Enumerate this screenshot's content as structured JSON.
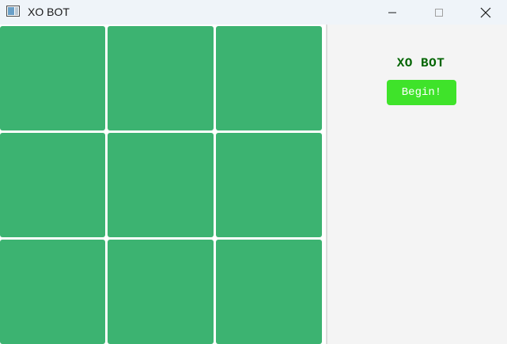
{
  "window": {
    "title": "XO BOT",
    "app_icon": "window-app-icon",
    "controls": [
      "minimize-icon",
      "maximize-icon",
      "close-icon"
    ]
  },
  "board": {
    "cells": [
      "",
      "",
      "",
      "",
      "",
      "",
      "",
      "",
      ""
    ],
    "cell_color": "#3cb371"
  },
  "side_panel": {
    "title": "XO BOT",
    "title_color": "#006400",
    "begin_label": "Begin!",
    "begin_color": "#3fe32a"
  }
}
